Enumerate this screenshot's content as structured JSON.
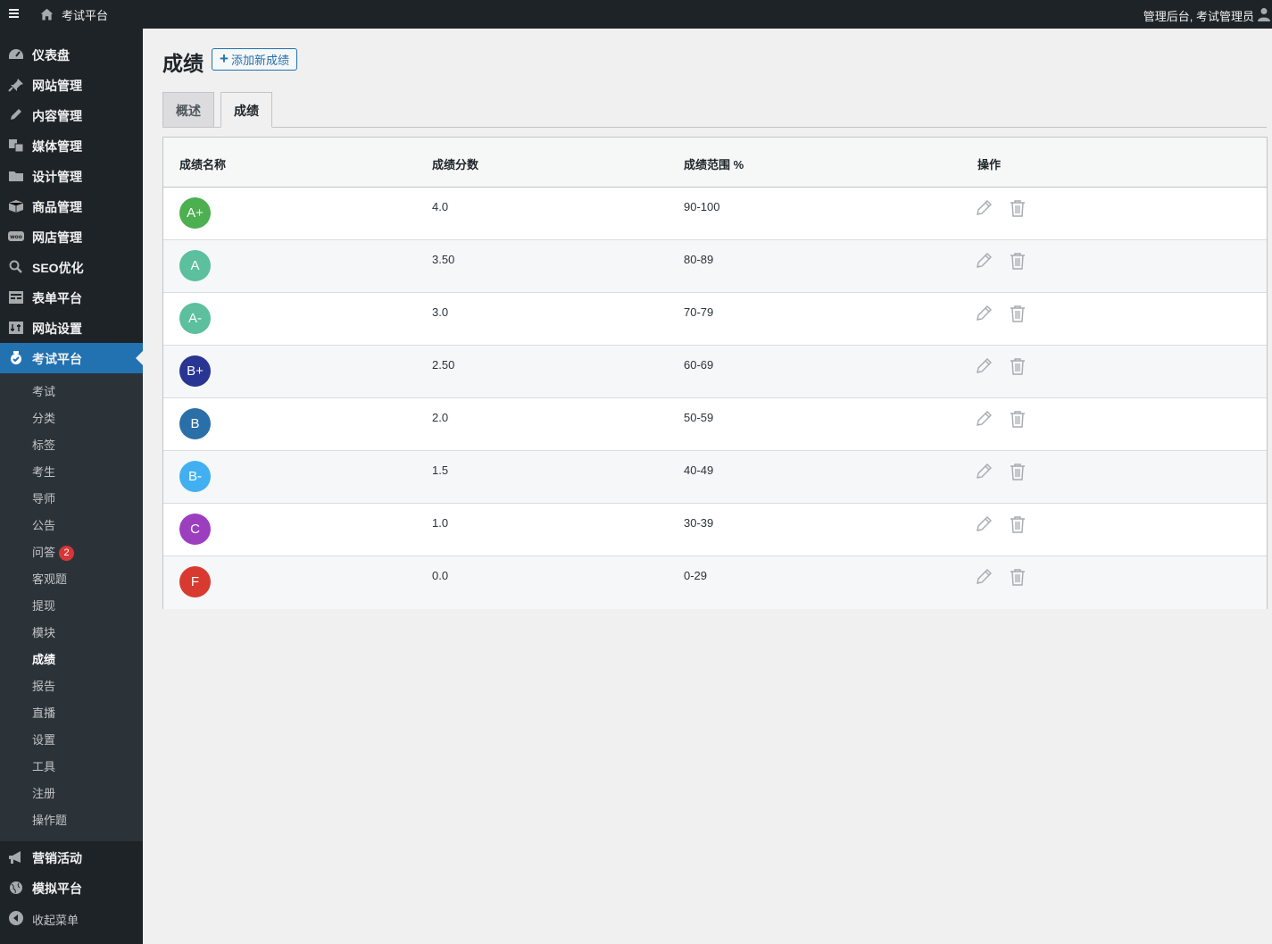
{
  "topbar": {
    "site_title": "考试平台",
    "user_greeting": "管理后台, 考试管理员"
  },
  "sidebar": {
    "menu": [
      {
        "label": "仪表盘",
        "icon": "dashboard-icon"
      },
      {
        "label": "网站管理",
        "icon": "pin-icon"
      },
      {
        "label": "内容管理",
        "icon": "pencil-icon"
      },
      {
        "label": "媒体管理",
        "icon": "media-icon"
      },
      {
        "label": "设计管理",
        "icon": "folder-icon"
      },
      {
        "label": "商品管理",
        "icon": "box-icon"
      },
      {
        "label": "网店管理",
        "icon": "woo-icon"
      },
      {
        "label": "SEO优化",
        "icon": "search-icon"
      },
      {
        "label": "表单平台",
        "icon": "form-icon"
      },
      {
        "label": "网站设置",
        "icon": "settings-icon"
      },
      {
        "label": "考试平台",
        "icon": "exam-icon",
        "active": true
      }
    ],
    "submenu": [
      "考试",
      "分类",
      "标签",
      "考生",
      "导师",
      "公告",
      "问答",
      "客观题",
      "提现",
      "模块",
      "成绩",
      "报告",
      "直播",
      "设置",
      "工具",
      "注册",
      "操作题"
    ],
    "submenu_badge": "2",
    "submenu_current": "成绩",
    "menu_after": [
      {
        "label": "营销活动",
        "icon": "megaphone-icon"
      },
      {
        "label": "模拟平台",
        "icon": "globe-icon"
      }
    ],
    "collapse_label": "收起菜单"
  },
  "main": {
    "page_title": "成绩",
    "add_button": "添加新成绩",
    "tabs": [
      "概述",
      "成绩"
    ],
    "active_tab": "成绩",
    "columns": [
      "成绩名称",
      "成绩分数",
      "成绩范围 %",
      "操作"
    ],
    "rows": [
      {
        "grade": "A+",
        "color": "#4caf50",
        "score": "4.0",
        "range": "90-100"
      },
      {
        "grade": "A",
        "color": "#5cbf9e",
        "score": "3.50",
        "range": "80-89"
      },
      {
        "grade": "A-",
        "color": "#5cbf9e",
        "score": "3.0",
        "range": "70-79"
      },
      {
        "grade": "B+",
        "color": "#283593",
        "score": "2.50",
        "range": "60-69"
      },
      {
        "grade": "B",
        "color": "#2a6fa8",
        "score": "2.0",
        "range": "50-59"
      },
      {
        "grade": "B-",
        "color": "#42b0f0",
        "score": "1.5",
        "range": "40-49"
      },
      {
        "grade": "C",
        "color": "#9c3fbf",
        "score": "1.0",
        "range": "30-39"
      },
      {
        "grade": "F",
        "color": "#d93a30",
        "score": "0.0",
        "range": "0-29"
      }
    ]
  }
}
